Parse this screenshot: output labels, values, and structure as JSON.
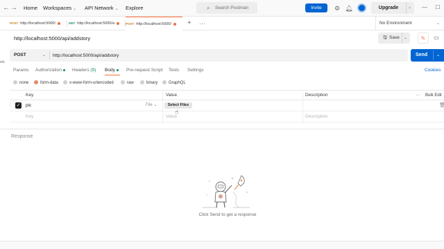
{
  "topbar": {
    "nav": [
      "Home",
      "Workspaces",
      "API Network",
      "Explore"
    ],
    "search_placeholder": "Search Postman",
    "invite_label": "Invite",
    "upgrade_label": "Upgrade"
  },
  "tabs": [
    {
      "method": "POST",
      "label": "http://localhost:5000/",
      "unsaved": true
    },
    {
      "method": "GET",
      "label": "http://localhost:5000/a",
      "unsaved": true
    },
    {
      "method": "POST",
      "label": "http://localhost:5000/",
      "unsaved": true,
      "active": true
    }
  ],
  "environment": {
    "label": "No Environment"
  },
  "request": {
    "title": "http://localhost:5000/api/addstory",
    "save_label": "Save",
    "method": "POST",
    "url": "http://localhost:5000/api/addstory",
    "send_label": "Send"
  },
  "config_tabs": {
    "params": "Params",
    "authorization": "Authorization",
    "headers": "Headers",
    "headers_count": "(9)",
    "body": "Body",
    "prerequest": "Pre-request Script",
    "tests": "Tests",
    "settings": "Settings",
    "cookies": "Cookies"
  },
  "sidebar_fragment": "ets",
  "body_types": [
    "none",
    "form-data",
    "x-www-form-urlencoded",
    "raw",
    "binary",
    "GraphQL"
  ],
  "body_type_selected": "form-data",
  "form_table": {
    "headers": {
      "key": "Key",
      "value": "Value",
      "description": "Description",
      "bulk_edit": "Bulk Edit"
    },
    "rows": [
      {
        "key": "pic",
        "type": "File",
        "value_button": "Select Files"
      }
    ],
    "placeholders": {
      "key": "Key",
      "value": "Value",
      "description": "Description"
    }
  },
  "response": {
    "label": "Response",
    "empty_message": "Click Send to get a response"
  },
  "colors": {
    "accent": "#ff6c37",
    "primary": "#0265d2"
  }
}
